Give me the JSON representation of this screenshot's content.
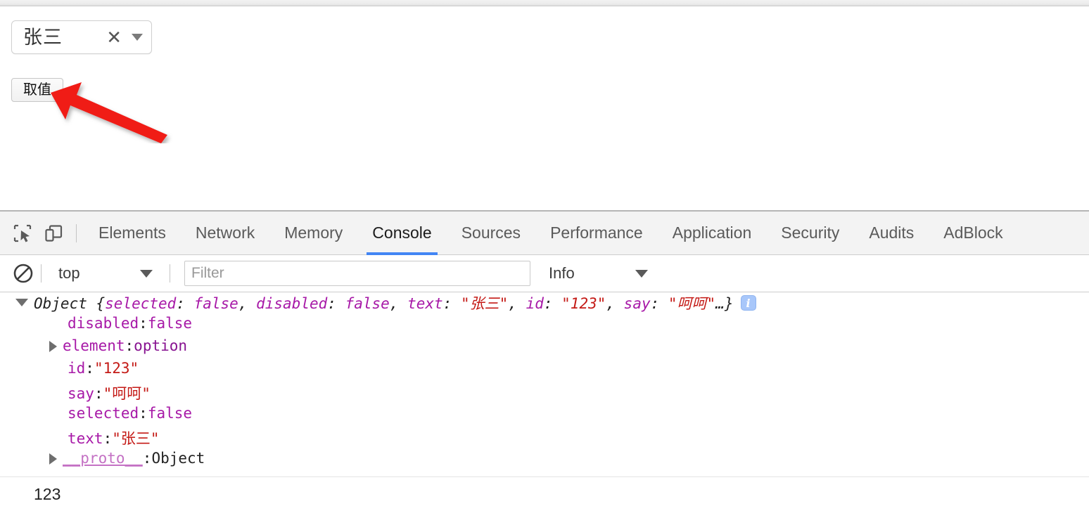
{
  "browser": {
    "chrome_strip": ""
  },
  "page_content": {
    "select": {
      "value": "张三",
      "clear_icon": "close-x-icon",
      "caret_icon": "chevron-down-icon"
    },
    "button": {
      "label": "取值"
    },
    "annotation": {
      "type": "red-arrow",
      "color": "#f01a18"
    }
  },
  "devtools": {
    "left_icons": [
      {
        "name": "inspect-element-icon"
      },
      {
        "name": "device-toolbar-icon"
      }
    ],
    "tabs": [
      {
        "label": "Elements",
        "active": false
      },
      {
        "label": "Network",
        "active": false
      },
      {
        "label": "Memory",
        "active": false
      },
      {
        "label": "Console",
        "active": true
      },
      {
        "label": "Sources",
        "active": false
      },
      {
        "label": "Performance",
        "active": false
      },
      {
        "label": "Application",
        "active": false
      },
      {
        "label": "Security",
        "active": false
      },
      {
        "label": "Audits",
        "active": false
      },
      {
        "label": "AdBlock",
        "active": false
      }
    ],
    "active_tab_underline_color": "#4285f4",
    "toolbar": {
      "clear_icon": "clear-console-icon",
      "context": {
        "value": "top",
        "caret_icon": "chevron-down-icon"
      },
      "filter": {
        "value": "",
        "placeholder": "Filter"
      },
      "level": {
        "value": "Info",
        "caret_icon": "chevron-down-icon"
      }
    },
    "console": {
      "messages": [
        {
          "kind": "object-expanded",
          "triangle": "triangle-down-icon",
          "preview": {
            "constructor": "Object",
            "open_brace": " {",
            "entries": [
              {
                "key": "selected",
                "sep": ": ",
                "value": "false",
                "value_type": "bool",
                "tail": ", "
              },
              {
                "key": "disabled",
                "sep": ": ",
                "value": "false",
                "value_type": "bool",
                "tail": ", "
              },
              {
                "key": "text",
                "sep": ": ",
                "value": "\"张三\"",
                "value_type": "string",
                "tail": ", "
              },
              {
                "key": "id",
                "sep": ": ",
                "value": "\"123\"",
                "value_type": "string",
                "tail": ", "
              },
              {
                "key": "say",
                "sep": ": ",
                "value": "\"呵呵\"",
                "value_type": "string",
                "tail": ""
              }
            ],
            "ellipsis": "…",
            "close_brace": "}"
          },
          "badge": "info-badge-icon",
          "properties": [
            {
              "triangle": null,
              "key": "disabled",
              "sep": ": ",
              "value": "false",
              "value_type": "bool"
            },
            {
              "triangle": "triangle-right-icon",
              "key": "element",
              "sep": ": ",
              "value": "option",
              "value_type": "plain"
            },
            {
              "triangle": null,
              "key": "id",
              "sep": ": ",
              "value": "\"123\"",
              "value_type": "string"
            },
            {
              "triangle": null,
              "key": "say",
              "sep": ": ",
              "value": "\"呵呵\"",
              "value_type": "string"
            },
            {
              "triangle": null,
              "key": "selected",
              "sep": ": ",
              "value": "false",
              "value_type": "bool"
            },
            {
              "triangle": null,
              "key": "text",
              "sep": ": ",
              "value": "\"张三\"",
              "value_type": "string"
            },
            {
              "triangle": "triangle-right-icon",
              "key": "__proto__",
              "sep": ": ",
              "value": "Object",
              "value_type": "object"
            }
          ]
        },
        {
          "kind": "plain",
          "text": "123"
        }
      ]
    }
  }
}
